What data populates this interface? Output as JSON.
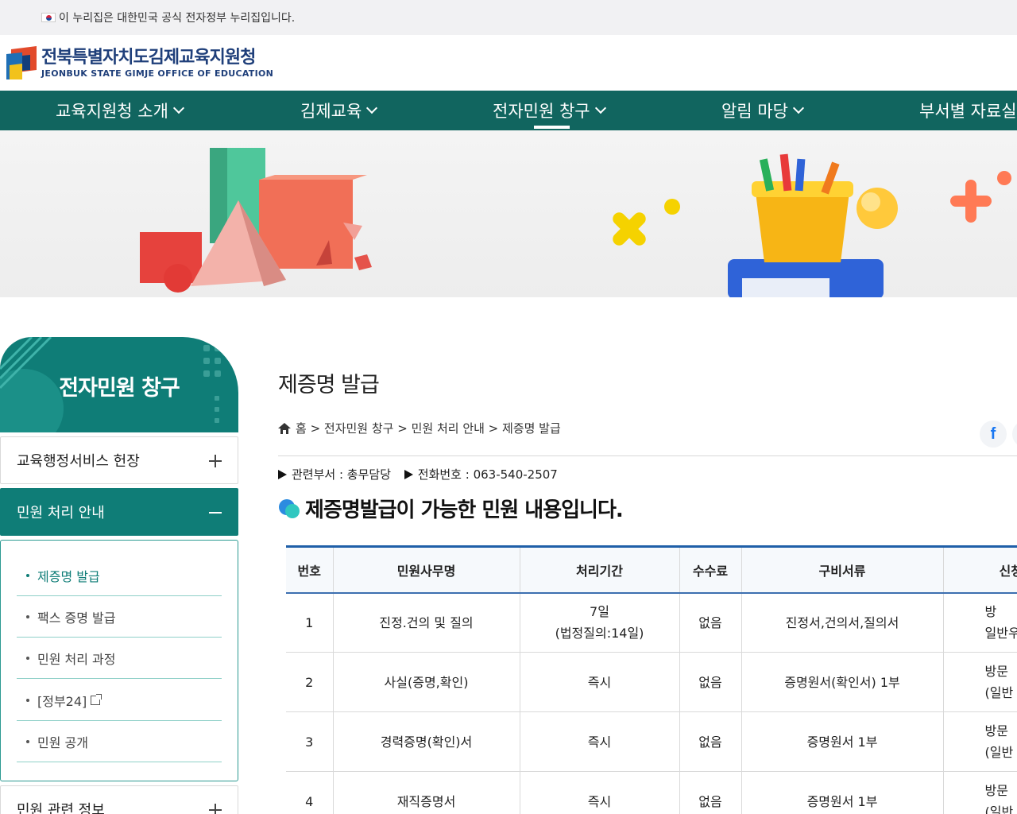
{
  "gov_bar": {
    "text": "이 누리집은 대한민국 공식 전자정부 누리집입니다."
  },
  "logo": {
    "ko": "전북특별자치도김제교육지원청",
    "en": "JEONBUK STATE GIMJE OFFICE OF EDUCATION"
  },
  "nav": [
    {
      "label": "교육지원청 소개"
    },
    {
      "label": "김제교육"
    },
    {
      "label": "전자민원 창구"
    },
    {
      "label": "알림 마당"
    },
    {
      "label": "부서별 자료실"
    }
  ],
  "sidebar": {
    "title": "전자민원 창구",
    "menus": [
      {
        "label": "교육행정서비스 헌장"
      },
      {
        "label": "민원 처리 안내"
      },
      {
        "label": "민원 관련 정보"
      }
    ],
    "sub_items": [
      {
        "label": "제증명 발급"
      },
      {
        "label": "팩스 증명 발급"
      },
      {
        "label": "민원 처리 과정"
      },
      {
        "label": "[정부24]"
      },
      {
        "label": "민원 공개"
      }
    ]
  },
  "content": {
    "page_title": "제증명 발급",
    "breadcrumb": "홈 > 전자민원 창구 > 민원 처리 안내 > 제증명 발급",
    "facebook_icon_glyph": "f",
    "dept_label": "관련부서 : 총무담당",
    "phone_label": "전화번호 : 063-540-2507",
    "section_title": "제증명발급이 가능한 민원 내용입니다."
  },
  "table": {
    "headers": [
      "번호",
      "민원사무명",
      "처리기간",
      "수수료",
      "구비서류",
      "신청"
    ],
    "rows": [
      [
        "1",
        "진정.건의 및 질의",
        "7일\n(법정질의:14일)",
        "없음",
        "진정서,건의서,질의서",
        "방\n일반우"
      ],
      [
        "2",
        "사실(증명,확인)",
        "즉시",
        "없음",
        "증명원서(확인서) 1부",
        "방문\n(일반"
      ],
      [
        "3",
        "경력증명(확인)서",
        "즉시",
        "없음",
        "증명원서 1부",
        "방문\n(일반"
      ],
      [
        "4",
        "재직증명서",
        "즉시",
        "없음",
        "증명원서 1부",
        "방문\n(일반"
      ]
    ]
  },
  "colors": {
    "nav_bg": "#11655f",
    "sidebar_accent": "#0f7d77",
    "table_top": "#1f5fa8",
    "logo_text": "#1f3f7a"
  }
}
